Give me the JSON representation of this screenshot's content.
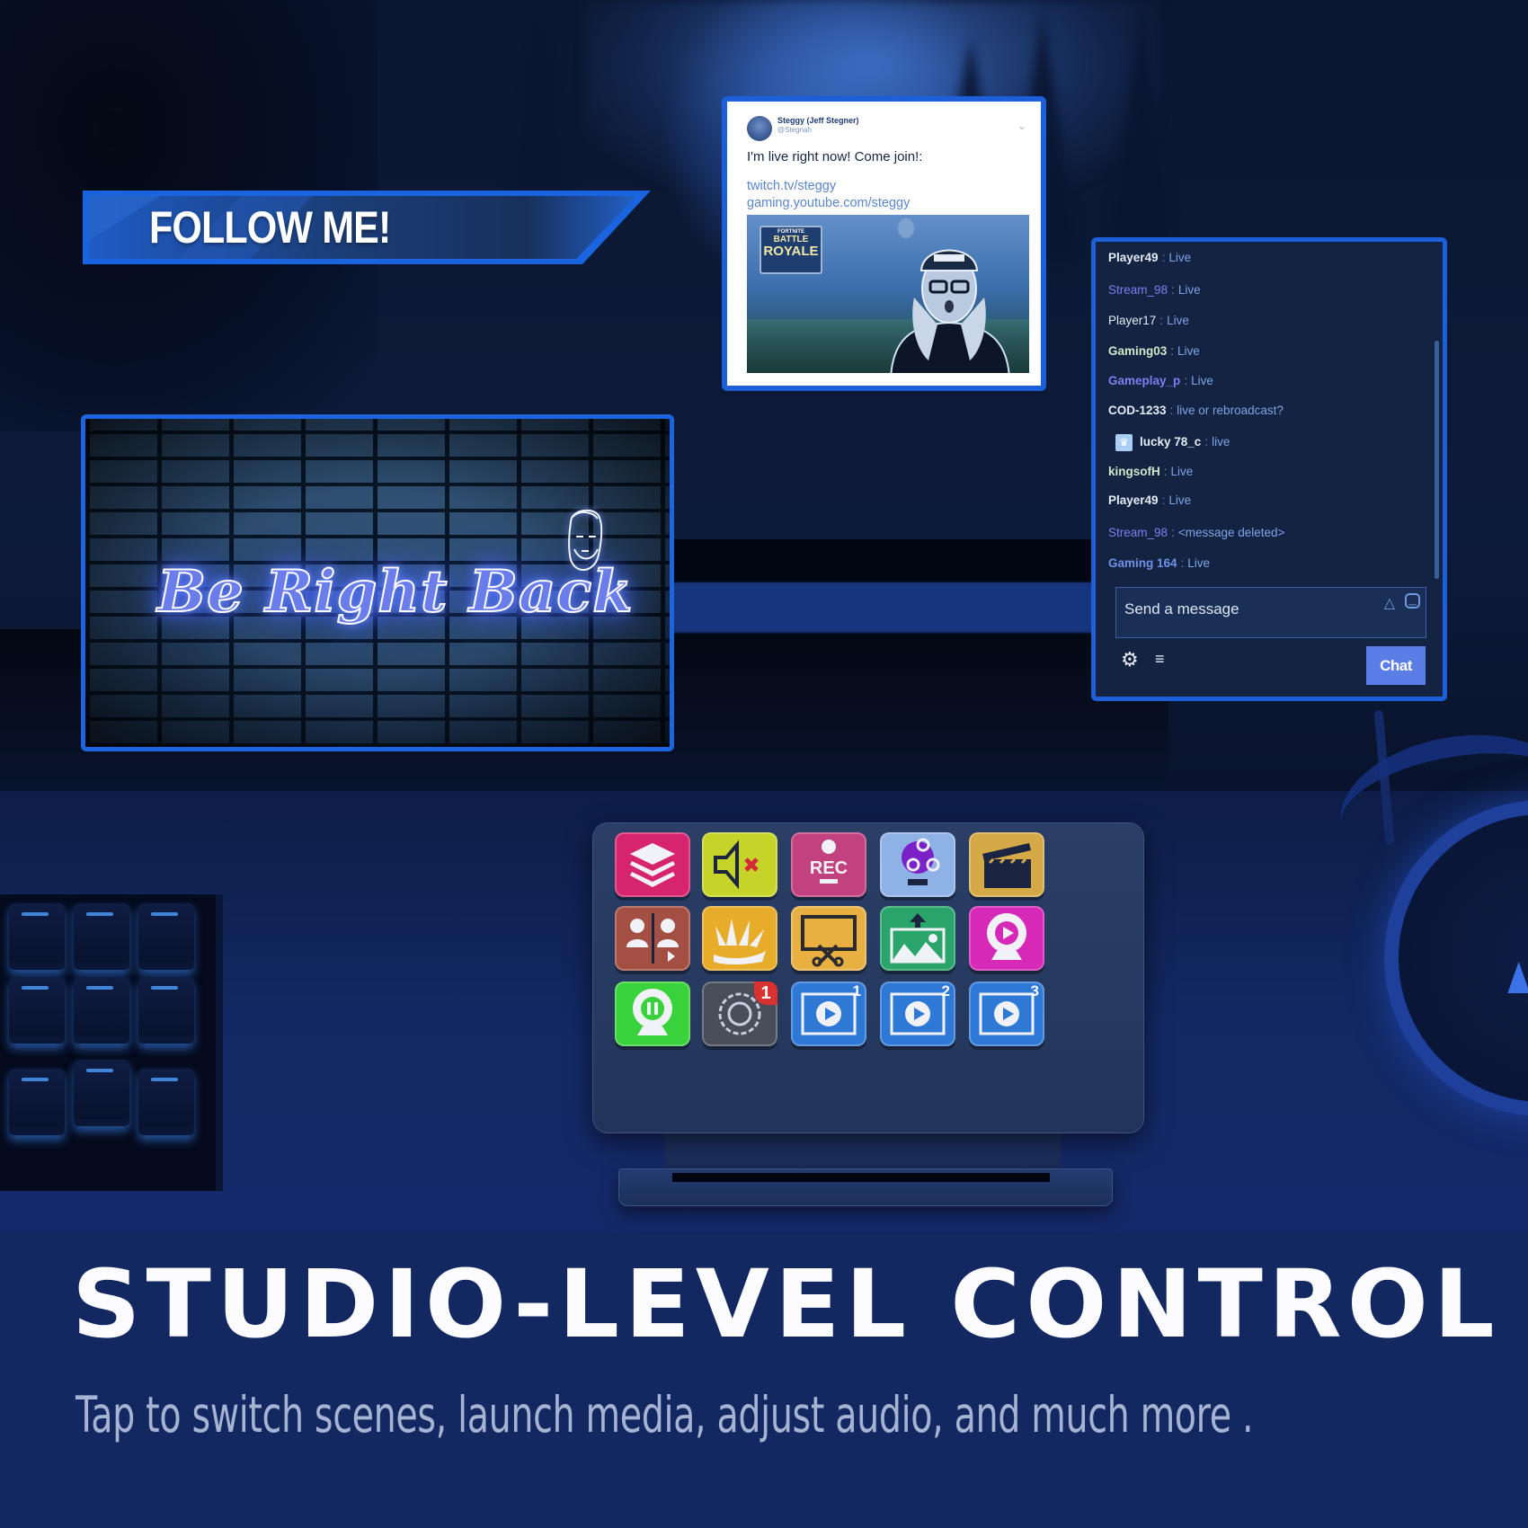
{
  "overlays": {
    "follow_banner": {
      "text": "FOLLOW ME!"
    },
    "brb_scene": {
      "text": "Be Right Back",
      "icon": "bearded-face-icon"
    },
    "tweet": {
      "author_name": "Steggy (Jeff Stegner)",
      "author_handle": "@Stegnah",
      "menu_icon": "chevron-down-icon",
      "body": "I'm live right now! Come join!:",
      "links": [
        "twitch.tv/steggy",
        "gaming.youtube.com/steggy"
      ],
      "media": {
        "logo_small": "FORTNITE",
        "logo_line1": "BATTLE",
        "logo_line2": "ROYALE"
      }
    },
    "chat": {
      "messages": [
        {
          "user": "Player49",
          "text": "Live",
          "user_color": "#e3ecf7",
          "bold": true,
          "badge": false
        },
        {
          "user": "Stream_98",
          "text": "Live",
          "user_color": "#7f7ff0",
          "bold": false,
          "badge": false
        },
        {
          "user": "Player17",
          "text": "Live",
          "user_color": "#e3ecf7",
          "bold": false,
          "badge": false
        },
        {
          "user": "Gaming03",
          "text": "Live",
          "user_color": "#cfe8c9",
          "bold": true,
          "badge": false
        },
        {
          "user": "Gameplay_p",
          "text": "Live",
          "user_color": "#7f7ff0",
          "bold": true,
          "badge": false
        },
        {
          "user": "COD-1233",
          "text": "live or rebroadcast?",
          "user_color": "#e3ecf7",
          "bold": true,
          "badge": false
        },
        {
          "user": "lucky 78_c",
          "text": "live",
          "user_color": "#e3ecf7",
          "bold": true,
          "badge": true,
          "badge_icon": "crown-icon"
        },
        {
          "user": "kingsofH",
          "text": "Live",
          "user_color": "#cfe8c9",
          "bold": true,
          "badge": false
        },
        {
          "user": "Player49",
          "text": "Live",
          "user_color": "#e3ecf7",
          "bold": true,
          "badge": false
        },
        {
          "user": "Stream_98",
          "text": "<message deleted>",
          "user_color": "#7f7ff0",
          "bold": false,
          "badge": false
        },
        {
          "user": "Gaming 164",
          "text": "Live",
          "user_color": "#6f92e6",
          "bold": true,
          "badge": false
        }
      ],
      "input_placeholder": "Send a message",
      "bits_icon": "bits-icon",
      "emoji_icon": "emoji-icon",
      "settings_icon": "gear-icon",
      "viewer_list_icon": "list-icon",
      "send_label": "Chat",
      "accent": "#5b7ee6"
    }
  },
  "device": {
    "keys": [
      {
        "name": "scenes",
        "icon": "layers-icon",
        "bg": "#d6246e"
      },
      {
        "name": "mute-audio",
        "icon": "speaker-mute-icon",
        "bg": "#c6d42a"
      },
      {
        "name": "record",
        "icon": "rec-icon",
        "bg": "#c2417f",
        "label": "REC"
      },
      {
        "name": "obs",
        "icon": "obs-logo-icon",
        "bg": "#8fb2e6"
      },
      {
        "name": "media-clip",
        "icon": "clapperboard-icon",
        "bg": "#d6a948"
      },
      {
        "name": "switch-camera",
        "icon": "split-people-icon",
        "bg": "#a44f44"
      },
      {
        "name": "effects",
        "icon": "confetti-icon",
        "bg": "#e6ac2a"
      },
      {
        "name": "crop-source",
        "icon": "monitor-scissors-icon",
        "bg": "#e8b040"
      },
      {
        "name": "upload-image",
        "icon": "image-upload-icon",
        "bg": "#2aa46a"
      },
      {
        "name": "webcam-play",
        "icon": "webcam-play-icon",
        "bg": "#d629b8"
      },
      {
        "name": "webcam-pause",
        "icon": "webcam-pause-icon",
        "bg": "#3ad23a"
      },
      {
        "name": "create-folder",
        "icon": "folder-gear-icon",
        "bg": "#4a4e5a",
        "badge": "1"
      },
      {
        "name": "play-video-1",
        "icon": "video-play-icon",
        "bg": "#2f79d6",
        "number": "1"
      },
      {
        "name": "play-video-2",
        "icon": "video-play-icon",
        "bg": "#2f79d6",
        "number": "2"
      },
      {
        "name": "play-video-3",
        "icon": "video-play-icon",
        "bg": "#2f79d6",
        "number": "3"
      }
    ]
  },
  "copy": {
    "headline": "STUDIO-LEVEL CONTROL",
    "subheadline": "Tap to switch scenes, launch media, adjust audio, and much more ."
  },
  "colors": {
    "panel_border": "#1c5fd8",
    "footer_bg": "#132860"
  }
}
